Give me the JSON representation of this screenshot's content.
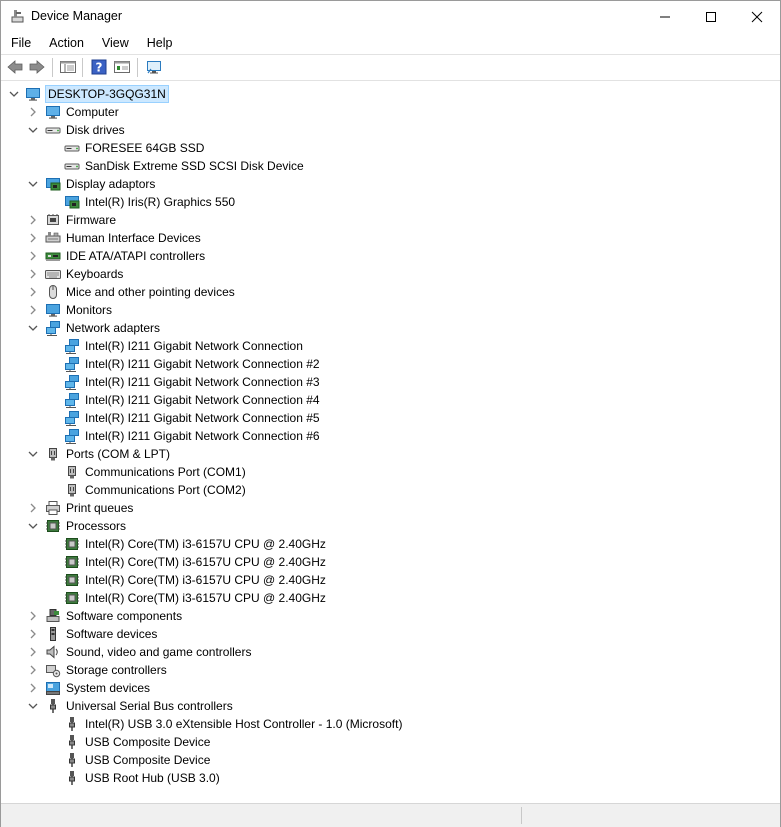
{
  "window": {
    "title": "Device Manager"
  },
  "menu": {
    "items": [
      "File",
      "Action",
      "View",
      "Help"
    ]
  },
  "tree": {
    "root": "DESKTOP-3GQG31N",
    "categories": [
      {
        "label": "Computer",
        "icon": "computer-icon",
        "expanded": false,
        "children": []
      },
      {
        "label": "Disk drives",
        "icon": "disk-drive-icon",
        "expanded": true,
        "children": [
          "FORESEE 64GB SSD",
          "SanDisk Extreme SSD SCSI Disk Device"
        ]
      },
      {
        "label": "Display adaptors",
        "icon": "display-adapter-icon",
        "expanded": true,
        "children": [
          "Intel(R) Iris(R) Graphics 550"
        ]
      },
      {
        "label": "Firmware",
        "icon": "firmware-icon",
        "expanded": false,
        "children": []
      },
      {
        "label": "Human Interface Devices",
        "icon": "hid-icon",
        "expanded": false,
        "children": []
      },
      {
        "label": "IDE ATA/ATAPI controllers",
        "icon": "ide-controller-icon",
        "expanded": false,
        "children": []
      },
      {
        "label": "Keyboards",
        "icon": "keyboard-icon",
        "expanded": false,
        "children": []
      },
      {
        "label": "Mice and other pointing devices",
        "icon": "mouse-icon",
        "expanded": false,
        "children": []
      },
      {
        "label": "Monitors",
        "icon": "monitor-icon",
        "expanded": false,
        "children": []
      },
      {
        "label": "Network adapters",
        "icon": "network-adapter-icon",
        "expanded": true,
        "children": [
          "Intel(R) I211 Gigabit Network Connection",
          "Intel(R) I211 Gigabit Network Connection #2",
          "Intel(R) I211 Gigabit Network Connection #3",
          "Intel(R) I211 Gigabit Network Connection #4",
          "Intel(R) I211 Gigabit Network Connection #5",
          "Intel(R) I211 Gigabit Network Connection #6"
        ]
      },
      {
        "label": "Ports (COM & LPT)",
        "icon": "port-icon",
        "expanded": true,
        "children": [
          "Communications Port (COM1)",
          "Communications Port (COM2)"
        ]
      },
      {
        "label": "Print queues",
        "icon": "printer-icon",
        "expanded": false,
        "children": []
      },
      {
        "label": "Processors",
        "icon": "processor-icon",
        "expanded": true,
        "children": [
          "Intel(R) Core(TM) i3-6157U CPU @ 2.40GHz",
          "Intel(R) Core(TM) i3-6157U CPU @ 2.40GHz",
          "Intel(R) Core(TM) i3-6157U CPU @ 2.40GHz",
          "Intel(R) Core(TM) i3-6157U CPU @ 2.40GHz"
        ]
      },
      {
        "label": "Software components",
        "icon": "software-component-icon",
        "expanded": false,
        "children": []
      },
      {
        "label": "Software devices",
        "icon": "software-device-icon",
        "expanded": false,
        "children": []
      },
      {
        "label": "Sound, video and game controllers",
        "icon": "speaker-icon",
        "expanded": false,
        "children": []
      },
      {
        "label": "Storage controllers",
        "icon": "storage-controller-icon",
        "expanded": false,
        "children": []
      },
      {
        "label": "System devices",
        "icon": "system-device-icon",
        "expanded": false,
        "children": []
      },
      {
        "label": "Universal Serial Bus controllers",
        "icon": "usb-icon",
        "expanded": true,
        "children": [
          "Intel(R) USB 3.0 eXtensible Host Controller - 1.0 (Microsoft)",
          "USB Composite Device",
          "USB Composite Device",
          "USB Root Hub (USB 3.0)"
        ]
      }
    ]
  },
  "colors": {
    "selection_bg": "#cce8ff",
    "selection_border": "#99d1ff",
    "accent_blue": "#1e7bd6"
  }
}
